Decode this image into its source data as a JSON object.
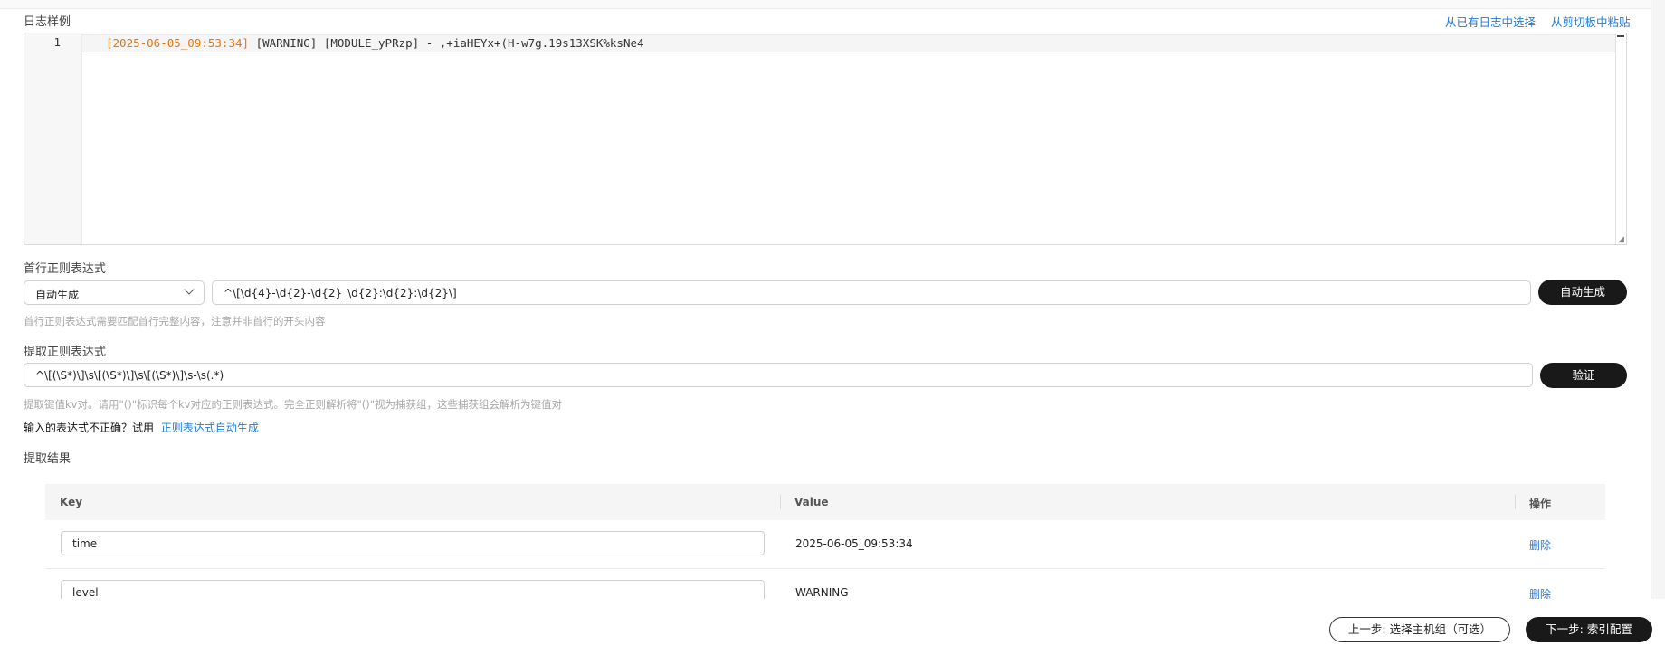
{
  "log_sample": {
    "label": "日志样例",
    "link_from_existing": "从已有日志中选择",
    "link_from_clipboard": "从剪切板中粘贴",
    "line_number": "1",
    "line_timestamp": "[2025-06-05_09:53:34]",
    "line_rest": " [WARNING] [MODULE_yPRzp] - ,+iaHEYx+(H-w7g.19s13XSK%ksNe4"
  },
  "first_line_regex": {
    "label": "首行正则表达式",
    "mode_selected": "自动生成",
    "value": "^\\[\\d{4}-\\d{2}-\\d{2}_\\d{2}:\\d{2}:\\d{2}\\]",
    "button": "自动生成",
    "hint": "首行正则表达式需要匹配首行完整内容，注意并非首行的开头内容"
  },
  "extract_regex": {
    "label": "提取正则表达式",
    "value": "^\\[(\\S*)\\]\\s\\[(\\S*)\\]\\s\\[(\\S*)\\]\\s-\\s(.*)",
    "button": "验证",
    "hint": "提取键值kv对。请用\"()\"标识每个kv对应的正则表达式。完全正则解析将\"()\"视为捕获组，这些捕获组会解析为键值对",
    "incorrect_prompt": "输入的表达式不正确？试用",
    "auto_generate_link": "正则表达式自动生成"
  },
  "results": {
    "label": "提取结果",
    "columns": {
      "key": "Key",
      "value": "Value",
      "action": "操作"
    },
    "rows": [
      {
        "key": "time",
        "value": "2025-06-05_09:53:34",
        "action": "删除"
      },
      {
        "key": "level",
        "value": "WARNING",
        "action": "删除"
      }
    ]
  },
  "footer": {
    "prev_button": "上一步: 选择主机组（可选）",
    "next_button": "下一步: 索引配置"
  },
  "colors": {
    "link": "#1f7ae0",
    "timestamp": "#e8750b",
    "primary_button": "#191919"
  }
}
